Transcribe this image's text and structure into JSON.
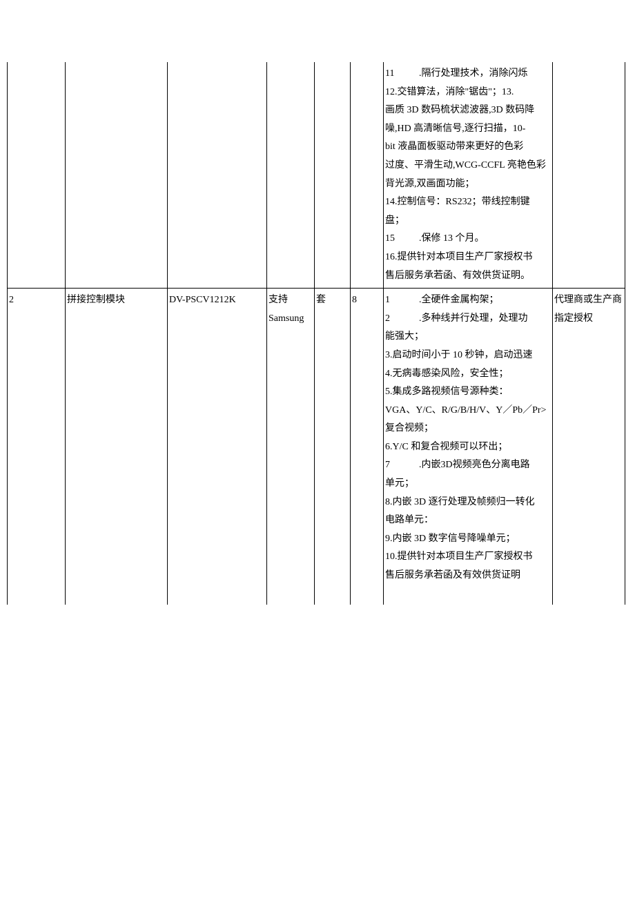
{
  "rows": [
    {
      "c1": "",
      "c2": "",
      "c3": "",
      "c4": "",
      "c5": "",
      "c6": "",
      "c7_lines": [
        {
          "num": "11",
          "text": ".隔行处理技术，消除闪烁"
        },
        {
          "text": "12.交错算法，消除\"锯齿\"；13."
        },
        {
          "text": "画质 3D 数码梳状滤波器,3D 数码降"
        },
        {
          "text": "噪,HD 高清晰信号,逐行扫描，10-"
        },
        {
          "text": "bit 液晶面板驱动带来更好的色彩"
        },
        {
          "text": "过度、平滑生动,WCG-CCFL 亮艳色彩"
        },
        {
          "text": "背光源,双画面功能；"
        },
        {
          "text": "14.控制信号：RS232；带线控制键"
        },
        {
          "text": "盘；"
        },
        {
          "num": "15",
          "text": ".保修 13 个月。"
        },
        {
          "text": "16.提供针对本项目生产厂家授权书"
        },
        {
          "text": "售后服务承若函、有效供货证明。"
        }
      ],
      "c8": ""
    },
    {
      "c1": "2",
      "c2": "拼接控制模块",
      "c3": "DV-PSCV1212K",
      "c4_line1": "支持",
      "c4_line2": "Samsung",
      "c5": "套",
      "c6": "8",
      "c7_lines": [
        {
          "num": "1",
          "text": ".全硬件金属构架；"
        },
        {
          "num": "2",
          "text": ".多种线并行处理，处理功"
        },
        {
          "text": "能强大；"
        },
        {
          "text": "3.启动时间小于 10 秒钟，启动迅速"
        },
        {
          "text": "4.无病毒感染风险，安全性；"
        },
        {
          "text": "5.集成多路视频信号源种类："
        },
        {
          "text": "VGA、Y/C、R/G/B/H/V、Y／Pb／Pr>"
        },
        {
          "text": "复合视频；"
        },
        {
          "text": "6.Y/C 和复合视频可以环出；"
        },
        {
          "num": "7",
          "text": ".内嵌3D视频亮色分离电路"
        },
        {
          "text": "单元；"
        },
        {
          "text": "8.内嵌 3D 逐行处理及帧频归一转化"
        },
        {
          "text": "电路单元："
        },
        {
          "text": "9.内嵌 3D 数字信号降噪单元；"
        },
        {
          "text": "10.提供针对本项目生产厂家授权书"
        },
        {
          "text": "售后服务承若函及有效供货证明"
        }
      ],
      "c8_line1": "代理商或生产商",
      "c8_line2": "指定授权"
    }
  ]
}
